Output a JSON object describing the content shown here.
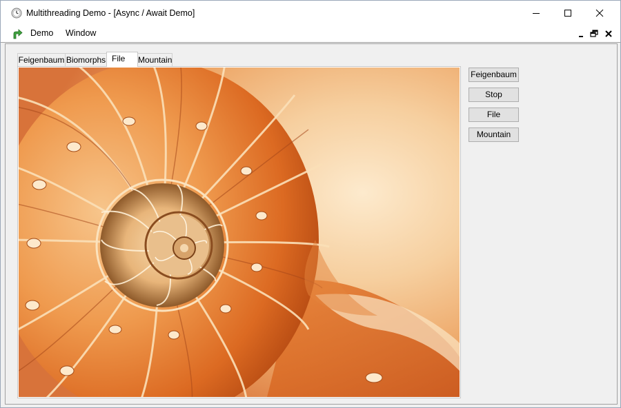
{
  "window": {
    "title": "Multithreading Demo - [Async / Await Demo]",
    "icons": {
      "app": "clock-icon",
      "minimize": "minimize-icon",
      "maximize": "maximize-icon",
      "close": "close-icon"
    }
  },
  "menubar": {
    "icon": "mdi-child-icon",
    "items": [
      {
        "label": "Demo"
      },
      {
        "label": "Window"
      }
    ],
    "mdi_controls": [
      "mdi-minimize-icon",
      "mdi-restore-icon",
      "mdi-close-icon"
    ]
  },
  "tabs": [
    {
      "label": "Feigenbaum",
      "active": false
    },
    {
      "label": "Biomorphs",
      "active": false
    },
    {
      "label": "File",
      "active": true
    },
    {
      "label": "Mountain",
      "active": false
    }
  ],
  "image": {
    "subject": "nautilus-shell",
    "colors": {
      "light": "#fde6c6",
      "mid": "#f2a860",
      "deep": "#d9631c",
      "dark": "#a9400f"
    }
  },
  "buttons": [
    {
      "label": "Feigenbaum"
    },
    {
      "label": "Stop"
    },
    {
      "label": "File"
    },
    {
      "label": "Mountain"
    }
  ]
}
